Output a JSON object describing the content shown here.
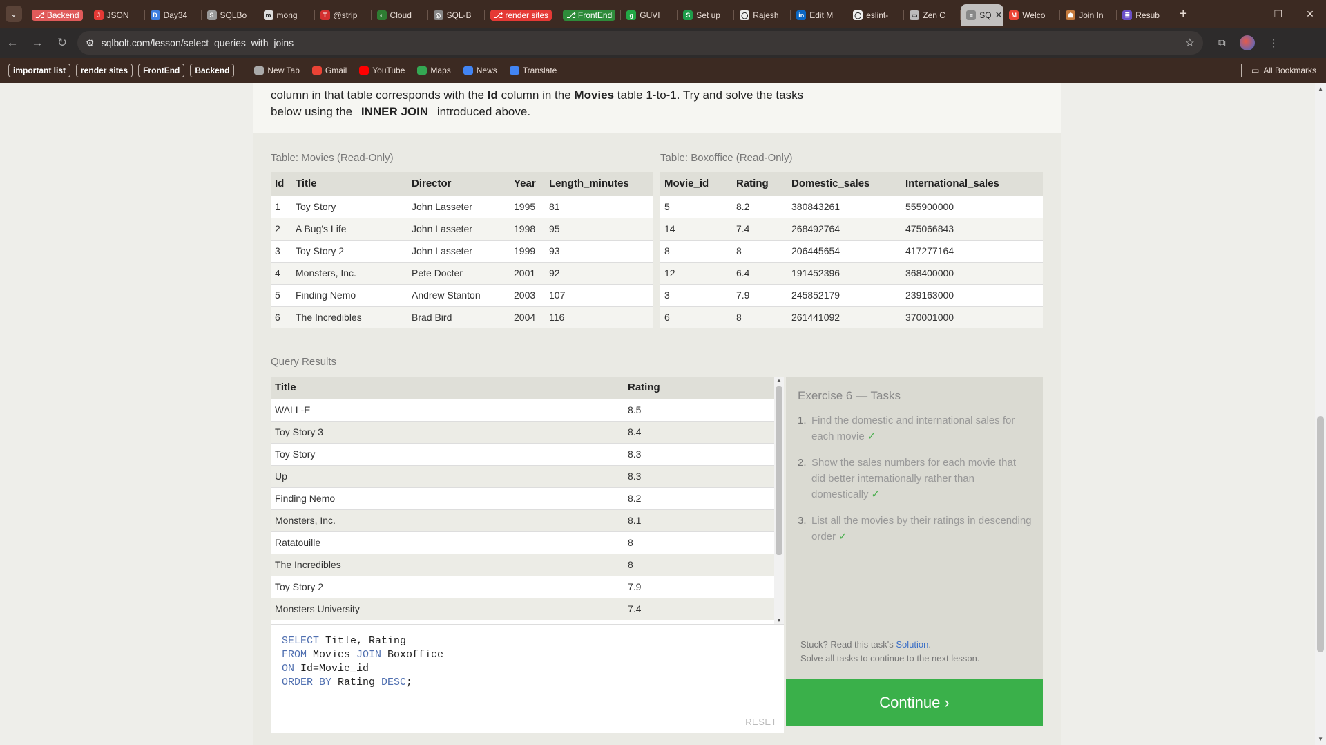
{
  "browser": {
    "tabs": [
      {
        "label": "Backend",
        "color": "#e05a5a",
        "kind": "pill",
        "fav": "⎇"
      },
      {
        "label": "JSON",
        "color": "#e53935",
        "kind": "tab",
        "fav": "J"
      },
      {
        "label": "Day34",
        "color": "#3d7ee0",
        "kind": "tab",
        "fav": "D"
      },
      {
        "label": "SQLBo",
        "color": "#999999",
        "kind": "tab",
        "fav": "S"
      },
      {
        "label": "mong",
        "color": "#dddddd",
        "kind": "tab",
        "fav": "m"
      },
      {
        "label": "@strip",
        "color": "#d32f2f",
        "kind": "tab",
        "fav": "T"
      },
      {
        "label": "Cloud",
        "color": "#2e7d32",
        "kind": "tab",
        "fav": "◐"
      },
      {
        "label": "SQL-B",
        "color": "#888888",
        "kind": "tab",
        "fav": "◎"
      },
      {
        "label": "render sites",
        "color": "#e53935",
        "kind": "pill",
        "fav": "⎇"
      },
      {
        "label": "FrontEnd",
        "color": "#2e8b3a",
        "kind": "pill",
        "fav": "⎇"
      },
      {
        "label": "GUVI",
        "color": "#22a745",
        "kind": "tab",
        "fav": "g"
      },
      {
        "label": "Set up",
        "color": "#1e9c4a",
        "kind": "tab",
        "fav": "S"
      },
      {
        "label": "Rajesh",
        "color": "#eeeeee",
        "kind": "tab",
        "fav": "◯"
      },
      {
        "label": "Edit M",
        "color": "#0a66c2",
        "kind": "tab",
        "fav": "in"
      },
      {
        "label": "eslint-",
        "color": "#eeeeee",
        "kind": "tab",
        "fav": "◯"
      },
      {
        "label": "Zen C",
        "color": "#bbbbbb",
        "kind": "tab",
        "fav": "▭"
      },
      {
        "label": "SQ",
        "color": "#888888",
        "kind": "active",
        "fav": "≡"
      },
      {
        "label": "Welco",
        "color": "#ea4335",
        "kind": "tab",
        "fav": "M"
      },
      {
        "label": "Join In",
        "color": "#c47a3d",
        "kind": "tab",
        "fav": "☗"
      },
      {
        "label": "Resub",
        "color": "#6a4fc7",
        "kind": "tab",
        "fav": "≣"
      }
    ],
    "url": "sqlbolt.com/lesson/select_queries_with_joins",
    "bookmarks": {
      "boxed": [
        "important list",
        "render sites",
        "FrontEnd",
        "Backend"
      ],
      "links": [
        {
          "label": "New Tab",
          "color": "#aaaaaa"
        },
        {
          "label": "Gmail",
          "color": "#ea4335"
        },
        {
          "label": "YouTube",
          "color": "#ff0000"
        },
        {
          "label": "Maps",
          "color": "#34a853"
        },
        {
          "label": "News",
          "color": "#4285f4"
        },
        {
          "label": "Translate",
          "color": "#4285f4"
        }
      ],
      "all": "All Bookmarks"
    }
  },
  "intro": {
    "line1_pre": "column in that table corresponds with the ",
    "line1_b1": "Id",
    "line1_mid": " column in the ",
    "line1_b2": "Movies",
    "line1_post": " table 1-to-1. Try and solve the tasks",
    "line2_pre": "below using the ",
    "line2_code": "INNER JOIN",
    "line2_post": " introduced above."
  },
  "movies": {
    "title": "Table: Movies (Read-Only)",
    "headers": [
      "Id",
      "Title",
      "Director",
      "Year",
      "Length_minutes"
    ],
    "rows": [
      [
        "1",
        "Toy Story",
        "John Lasseter",
        "1995",
        "81"
      ],
      [
        "2",
        "A Bug's Life",
        "John Lasseter",
        "1998",
        "95"
      ],
      [
        "3",
        "Toy Story 2",
        "John Lasseter",
        "1999",
        "93"
      ],
      [
        "4",
        "Monsters, Inc.",
        "Pete Docter",
        "2001",
        "92"
      ],
      [
        "5",
        "Finding Nemo",
        "Andrew Stanton",
        "2003",
        "107"
      ],
      [
        "6",
        "The Incredibles",
        "Brad Bird",
        "2004",
        "116"
      ]
    ]
  },
  "boxoffice": {
    "title": "Table: Boxoffice (Read-Only)",
    "headers": [
      "Movie_id",
      "Rating",
      "Domestic_sales",
      "International_sales"
    ],
    "rows": [
      [
        "5",
        "8.2",
        "380843261",
        "555900000"
      ],
      [
        "14",
        "7.4",
        "268492764",
        "475066843"
      ],
      [
        "8",
        "8",
        "206445654",
        "417277164"
      ],
      [
        "12",
        "6.4",
        "191452396",
        "368400000"
      ],
      [
        "3",
        "7.9",
        "245852179",
        "239163000"
      ],
      [
        "6",
        "8",
        "261441092",
        "370001000"
      ]
    ]
  },
  "results": {
    "title": "Query Results",
    "headers": [
      "Title",
      "Rating"
    ],
    "rows": [
      [
        "WALL-E",
        "8.5"
      ],
      [
        "Toy Story 3",
        "8.4"
      ],
      [
        "Toy Story",
        "8.3"
      ],
      [
        "Up",
        "8.3"
      ],
      [
        "Finding Nemo",
        "8.2"
      ],
      [
        "Monsters, Inc.",
        "8.1"
      ],
      [
        "Ratatouille",
        "8"
      ],
      [
        "The Incredibles",
        "8"
      ],
      [
        "Toy Story 2",
        "7.9"
      ],
      [
        "Monsters University",
        "7.4"
      ]
    ]
  },
  "editor": {
    "lines": [
      [
        {
          "kw": "SELECT"
        },
        {
          "t": " Title, Rating"
        }
      ],
      [
        {
          "kw": "FROM"
        },
        {
          "t": " Movies "
        },
        {
          "kw": "JOIN"
        },
        {
          "t": " Boxoffice"
        }
      ],
      [
        {
          "kw": "ON"
        },
        {
          "t": " Id=Movie_id"
        }
      ],
      [
        {
          "kw": "ORDER BY"
        },
        {
          "t": " Rating "
        },
        {
          "kw": "DESC"
        },
        {
          "t": ";"
        }
      ]
    ],
    "reset": "RESET"
  },
  "tasks": {
    "heading": "Exercise 6 — Tasks",
    "items": [
      {
        "num": "1.",
        "text": "Find the domestic and international sales for each movie",
        "check": "✓"
      },
      {
        "num": "2.",
        "text": "Show the sales numbers for each movie that did better internationally rather than domestically",
        "check": "✓"
      },
      {
        "num": "3.",
        "text": "List all the movies by their ratings in descending order",
        "check": "✓"
      }
    ],
    "stuck_pre": "Stuck? Read this task's ",
    "stuck_link": "Solution",
    "stuck_post": ".",
    "stuck_line2": "Solve all tasks to continue to the next lesson."
  },
  "continue_label": "Continue ›"
}
